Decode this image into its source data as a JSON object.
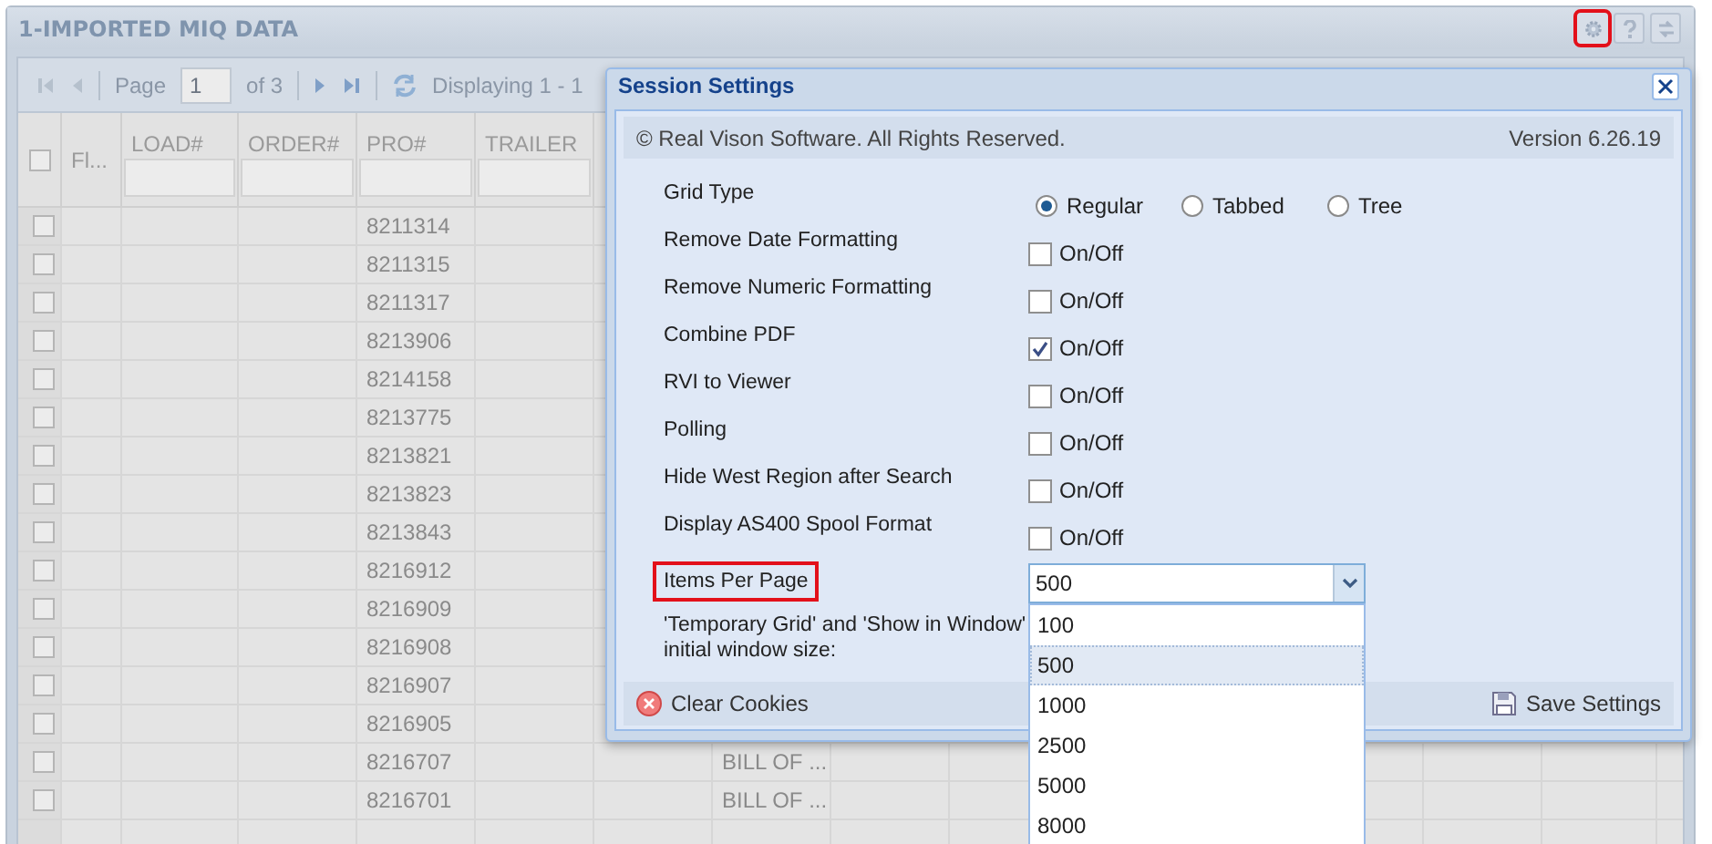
{
  "panel": {
    "title": "1-IMPORTED MIQ DATA",
    "tools": [
      {
        "kind": "gear",
        "highlighted": true
      },
      {
        "kind": "help",
        "highlighted": false
      },
      {
        "kind": "refresh",
        "highlighted": false
      }
    ]
  },
  "toolbar": {
    "page_label": "Page",
    "page_value": "1",
    "page_count": "of 3",
    "displaying": "Displaying 1 - 1"
  },
  "grid": {
    "select_all_checked": false,
    "columns": [
      "Fl...",
      "LOAD#",
      "ORDER#",
      "PRO#",
      "TRAILER"
    ],
    "rows": [
      {
        "checked": false,
        "pro": "8211314"
      },
      {
        "checked": false,
        "pro": "8211315"
      },
      {
        "checked": false,
        "pro": "8211317"
      },
      {
        "checked": false,
        "pro": "8213906"
      },
      {
        "checked": false,
        "pro": "8214158"
      },
      {
        "checked": false,
        "pro": "8213775"
      },
      {
        "checked": false,
        "pro": "8213821"
      },
      {
        "checked": false,
        "pro": "8213823"
      },
      {
        "checked": false,
        "pro": "8213843"
      },
      {
        "checked": false,
        "pro": "8216912"
      },
      {
        "checked": false,
        "pro": "8216909"
      },
      {
        "checked": false,
        "pro": "8216908"
      },
      {
        "checked": false,
        "pro": "8216907"
      },
      {
        "checked": false,
        "pro": "8216905"
      },
      {
        "checked": false,
        "pro": "8216707",
        "column_8": "BILL OF ..."
      },
      {
        "checked": false,
        "pro": "8216701",
        "column_8": "BILL OF ..."
      }
    ]
  },
  "dialog": {
    "title": "Session Settings",
    "copyright": "© Real Vison Software. All Rights Reserved.",
    "version": "Version 6.26.19",
    "settings": [
      {
        "kind": "radio",
        "label": "Grid Type",
        "highlighted": false,
        "options": [
          {
            "label": "Regular",
            "selected": true
          },
          {
            "label": "Tabbed",
            "selected": false
          },
          {
            "label": "Tree",
            "selected": false
          }
        ]
      },
      {
        "kind": "checkbox",
        "label": "Remove Date Formatting",
        "highlighted": false,
        "checked": false,
        "text": "On/Off"
      },
      {
        "kind": "checkbox",
        "label": "Remove Numeric Formatting",
        "highlighted": false,
        "checked": false,
        "text": "On/Off"
      },
      {
        "kind": "checkbox",
        "label": "Combine PDF",
        "highlighted": false,
        "checked": true,
        "text": "On/Off"
      },
      {
        "kind": "checkbox",
        "label": "RVI to Viewer",
        "highlighted": false,
        "checked": false,
        "text": "On/Off"
      },
      {
        "kind": "checkbox",
        "label": "Polling",
        "highlighted": false,
        "checked": false,
        "text": "On/Off"
      },
      {
        "kind": "checkbox",
        "label": "Hide West Region after Search",
        "highlighted": false,
        "checked": false,
        "text": "On/Off"
      },
      {
        "kind": "checkbox",
        "label": "Display AS400 Spool Format",
        "highlighted": false,
        "checked": false,
        "text": "On/Off"
      },
      {
        "kind": "combo",
        "label": "Items Per Page",
        "highlighted": true,
        "value": "500",
        "expanded": true,
        "options": [
          {
            "label": "100",
            "selected": false
          },
          {
            "label": "500",
            "selected": true
          },
          {
            "label": "1000",
            "selected": false
          },
          {
            "label": "2500",
            "selected": false
          },
          {
            "label": "5000",
            "selected": false
          },
          {
            "label": "8000",
            "selected": false
          }
        ]
      },
      {
        "kind": "label",
        "label": "'Temporary Grid' and 'Show in Window' initial window size:",
        "highlighted": false
      }
    ],
    "clear_button": "Clear Cookies",
    "save_button": "Save Settings"
  }
}
